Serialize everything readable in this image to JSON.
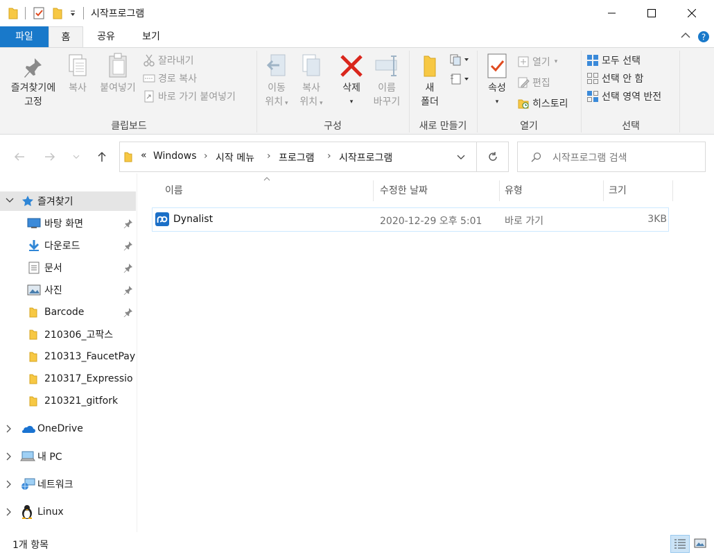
{
  "window": {
    "title": "시작프로그램",
    "controls": [
      "minimize",
      "maximize",
      "close"
    ]
  },
  "ribbon_tabs": [
    {
      "label": "파일"
    },
    {
      "label": "홈"
    },
    {
      "label": "공유"
    },
    {
      "label": "보기"
    }
  ],
  "ribbon": {
    "clipboard": {
      "label": "클립보드",
      "pin_label_1": "즐겨찾기에",
      "pin_label_2": "고정",
      "copy": "복사",
      "paste": "붙여넣기",
      "cut": "잘라내기",
      "copy_path": "경로 복사",
      "paste_shortcut": "바로 가기 붙여넣기"
    },
    "organize": {
      "label": "구성",
      "move_1": "이동",
      "move_2": "위치",
      "copyto_1": "복사",
      "copyto_2": "위치",
      "delete": "삭제",
      "rename_1": "이름",
      "rename_2": "바꾸기"
    },
    "new": {
      "label": "새로 만들기",
      "folder_1": "새",
      "folder_2": "폴더"
    },
    "open": {
      "label": "열기",
      "properties": "속성",
      "open": "열기",
      "edit": "편집",
      "history": "히스토리"
    },
    "select": {
      "label": "선택",
      "select_all": "모두 선택",
      "select_none": "선택 안 함",
      "invert": "선택 영역 반전"
    }
  },
  "address": {
    "overflow": "«",
    "crumbs": [
      "Windows",
      "시작 메뉴",
      "프로그램",
      "시작프로그램"
    ],
    "search_placeholder": "시작프로그램 검색"
  },
  "nav_pane": {
    "quick_access": "즐겨찾기",
    "quick_items": [
      {
        "label": "바탕 화면",
        "pinned": true
      },
      {
        "label": "다운로드",
        "pinned": true
      },
      {
        "label": "문서",
        "pinned": true
      },
      {
        "label": "사진",
        "pinned": true
      },
      {
        "label": "Barcode",
        "pinned": true
      },
      {
        "label": "210306_고팍스",
        "pinned": false
      },
      {
        "label": "210313_FaucetPay",
        "pinned": false
      },
      {
        "label": "210317_Expressio",
        "pinned": false
      },
      {
        "label": "210321_gitfork",
        "pinned": false
      }
    ],
    "roots": [
      {
        "label": "OneDrive"
      },
      {
        "label": "내 PC"
      },
      {
        "label": "네트워크"
      },
      {
        "label": "Linux"
      }
    ]
  },
  "file_list": {
    "columns": [
      "이름",
      "수정한 날짜",
      "유형",
      "크기"
    ],
    "rows": [
      {
        "name": "Dynalist",
        "modified": "2020-12-29 오후 5:01",
        "type": "바로 가기",
        "size": "3KB"
      }
    ]
  },
  "status": {
    "item_count": "1개 항목"
  },
  "colors": {
    "accent": "#1979ca",
    "selection_border": "#cce8ff",
    "ribbon_bg": "#f3f3f3",
    "delete_red": "#d9261c",
    "folder_yellow": "#f7c844"
  }
}
